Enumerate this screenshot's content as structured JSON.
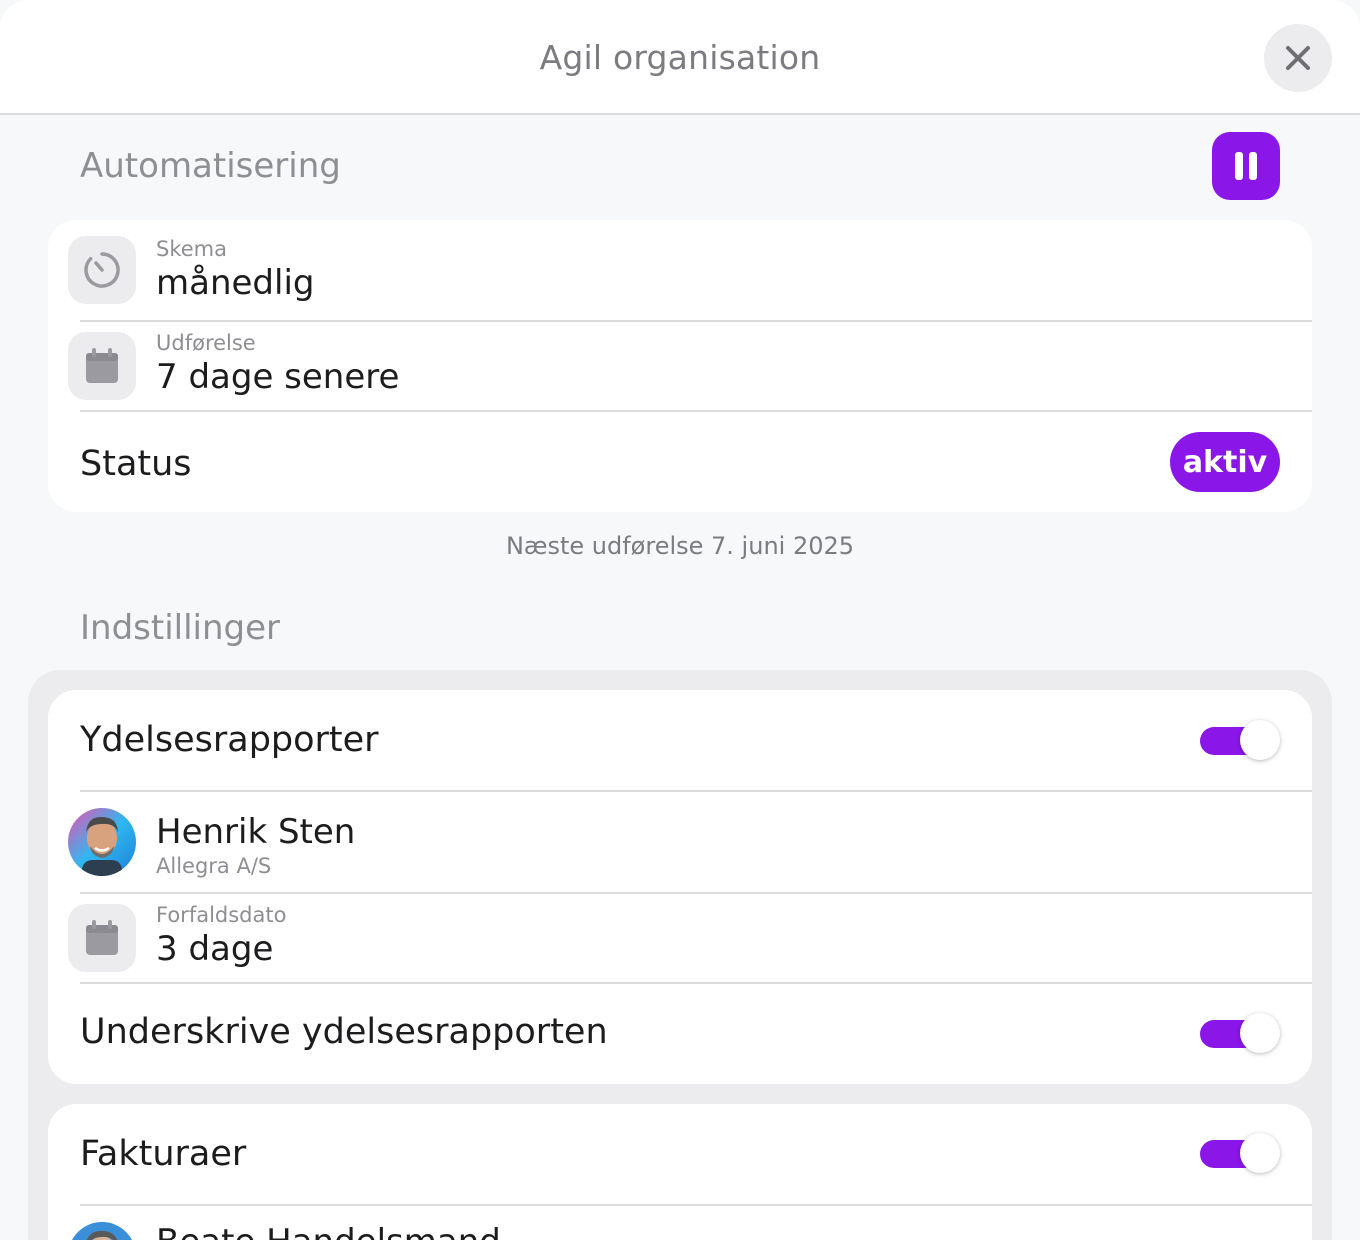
{
  "header": {
    "title": "Agil organisation"
  },
  "automation": {
    "section_title": "Automatisering",
    "schedule": {
      "label": "Skema",
      "value": "månedlig"
    },
    "execution": {
      "label": "Udførelse",
      "value": "7 dage senere"
    },
    "status": {
      "label": "Status",
      "badge": "aktiv"
    },
    "next_run": "Næste udførelse 7. juni 2025"
  },
  "settings": {
    "section_title": "Indstillinger",
    "performance": {
      "title": "Ydelsesrapporter",
      "enabled": true,
      "person": {
        "name": "Henrik Sten",
        "org": "Allegra A/S"
      },
      "due": {
        "label": "Forfaldsdato",
        "value": "3 dage"
      },
      "sign": {
        "label": "Underskrive ydelsesrapporten",
        "enabled": true
      }
    },
    "invoices": {
      "title": "Fakturaer",
      "enabled": true,
      "person": {
        "name": "Beate Handelsmand"
      }
    }
  },
  "colors": {
    "accent": "#8a16e8"
  },
  "icons": [
    "close-icon",
    "pause-icon",
    "timer-icon",
    "calendar-icon",
    "avatar"
  ]
}
